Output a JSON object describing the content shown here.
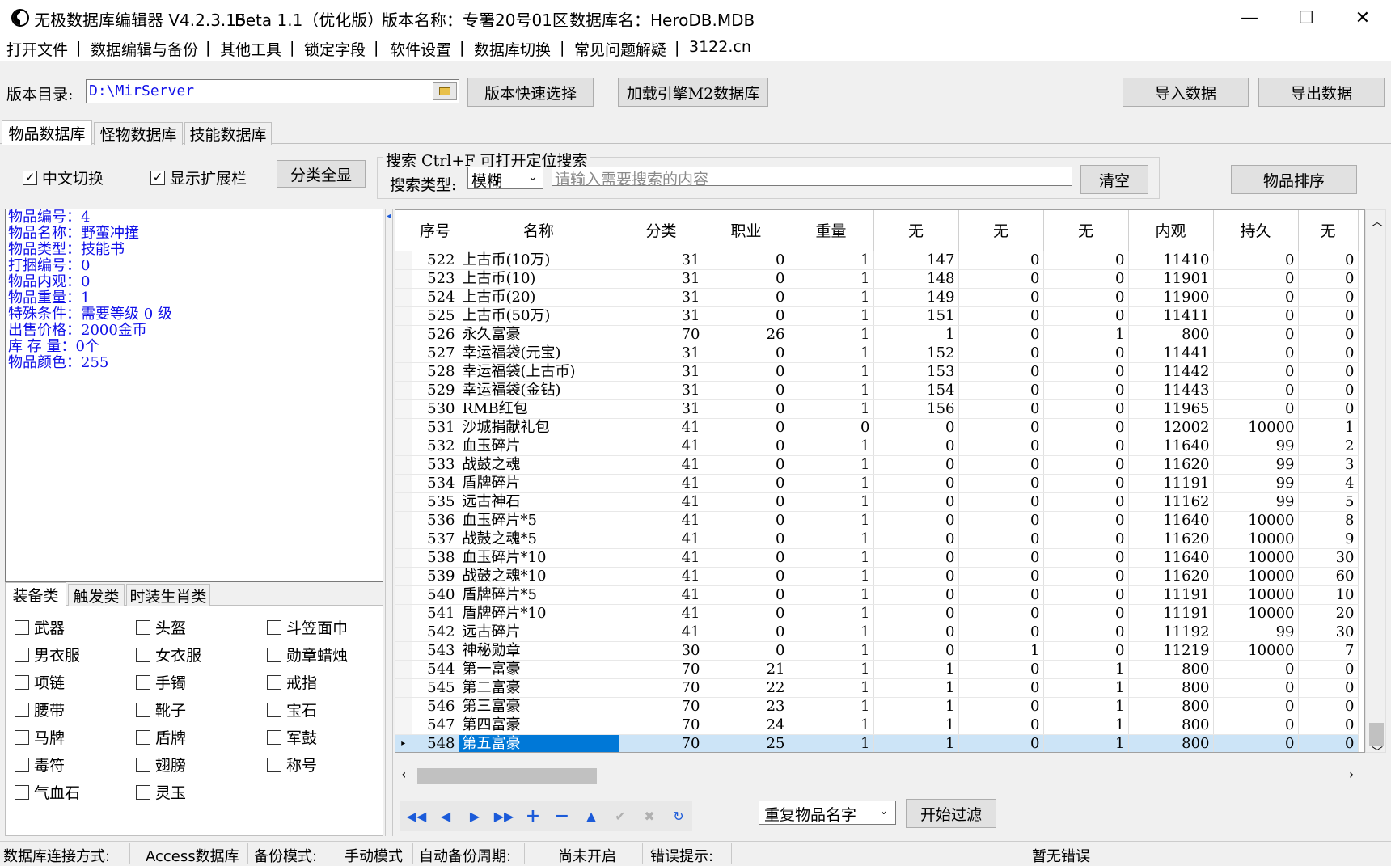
{
  "titlebar": {
    "app": "无极数据库编辑器 V4.2.3.15",
    "beta": "Beta 1.1（优化版）",
    "version_name": "版本名称：专署20号01区",
    "db_name": "数据库名：HeroDB.MDB",
    "minimize": "—",
    "maximize": "☐",
    "close": "✕"
  },
  "menu": [
    "打开文件",
    "数据编辑与备份",
    "其他工具",
    "锁定字段",
    "软件设置",
    "数据库切换",
    "常见问题解疑",
    "3122.cn"
  ],
  "menu_sep": "|",
  "toolbar": {
    "dir_label": "版本目录:",
    "dir_value": "D:\\MirServer",
    "quick_select": "版本快速选择",
    "load_m2": "加载引擎M2数据库",
    "import": "导入数据",
    "export": "导出数据"
  },
  "tabs": [
    "物品数据库",
    "怪物数据库",
    "技能数据库"
  ],
  "options": {
    "chinese_switch": "中文切换",
    "show_ext": "显示扩展栏",
    "show_all_cat": "分类全显",
    "check": "✓"
  },
  "search": {
    "group_title": "搜索  Ctrl+F 可打开定位搜索",
    "type_label": "搜索类型:",
    "type_value": "模糊",
    "placeholder": "请输入需要搜索的内容",
    "clear": "清空",
    "sort": "物品排序"
  },
  "info": [
    "物品编号：4",
    "物品名称：野蛮冲撞",
    "物品类型：技能书",
    "打捆编号：0",
    "物品内观：0",
    "物品重量：1",
    "特殊条件：需要等级 0 级",
    "出售价格：2000金币",
    "库 存 量：0个",
    "物品颜色：255"
  ],
  "category_tabs": [
    "装备类",
    "触发类",
    "时装生肖类"
  ],
  "categories": [
    [
      "武器",
      "头盔",
      "斗笠面巾"
    ],
    [
      "男衣服",
      "女衣服",
      "勋章蜡烛"
    ],
    [
      "项链",
      "手镯",
      "戒指"
    ],
    [
      "腰带",
      "靴子",
      "宝石"
    ],
    [
      "马牌",
      "盾牌",
      "军鼓"
    ],
    [
      "毒符",
      "翅膀",
      "称号"
    ],
    [
      "气血石",
      "灵玉"
    ]
  ],
  "grid": {
    "columns": [
      "序号",
      "名称",
      "分类",
      "职业",
      "重量",
      "无",
      "无",
      "无",
      "内观",
      "持久",
      "无"
    ],
    "rows": [
      [
        "522",
        "上古币(10万)",
        "31",
        "0",
        "1",
        "147",
        "0",
        "0",
        "11410",
        "0",
        "0"
      ],
      [
        "523",
        "上古币(10)",
        "31",
        "0",
        "1",
        "148",
        "0",
        "0",
        "11901",
        "0",
        "0"
      ],
      [
        "524",
        "上古币(20)",
        "31",
        "0",
        "1",
        "149",
        "0",
        "0",
        "11900",
        "0",
        "0"
      ],
      [
        "525",
        "上古币(50万)",
        "31",
        "0",
        "1",
        "151",
        "0",
        "0",
        "11411",
        "0",
        "0"
      ],
      [
        "526",
        "永久富豪",
        "70",
        "26",
        "1",
        "1",
        "0",
        "1",
        "800",
        "0",
        "0"
      ],
      [
        "527",
        "幸运福袋(元宝)",
        "31",
        "0",
        "1",
        "152",
        "0",
        "0",
        "11441",
        "0",
        "0"
      ],
      [
        "528",
        "幸运福袋(上古币)",
        "31",
        "0",
        "1",
        "153",
        "0",
        "0",
        "11442",
        "0",
        "0"
      ],
      [
        "529",
        "幸运福袋(金钻)",
        "31",
        "0",
        "1",
        "154",
        "0",
        "0",
        "11443",
        "0",
        "0"
      ],
      [
        "530",
        "RMB红包",
        "31",
        "0",
        "1",
        "156",
        "0",
        "0",
        "11965",
        "0",
        "0"
      ],
      [
        "531",
        "沙城捐献礼包",
        "41",
        "0",
        "0",
        "0",
        "0",
        "0",
        "12002",
        "10000",
        "1"
      ],
      [
        "532",
        "血玉碎片",
        "41",
        "0",
        "1",
        "0",
        "0",
        "0",
        "11640",
        "99",
        "2"
      ],
      [
        "533",
        "战鼓之魂",
        "41",
        "0",
        "1",
        "0",
        "0",
        "0",
        "11620",
        "99",
        "3"
      ],
      [
        "534",
        "盾牌碎片",
        "41",
        "0",
        "1",
        "0",
        "0",
        "0",
        "11191",
        "99",
        "4"
      ],
      [
        "535",
        "远古神石",
        "41",
        "0",
        "1",
        "0",
        "0",
        "0",
        "11162",
        "99",
        "5"
      ],
      [
        "536",
        "血玉碎片*5",
        "41",
        "0",
        "1",
        "0",
        "0",
        "0",
        "11640",
        "10000",
        "8"
      ],
      [
        "537",
        "战鼓之魂*5",
        "41",
        "0",
        "1",
        "0",
        "0",
        "0",
        "11620",
        "10000",
        "9"
      ],
      [
        "538",
        "血玉碎片*10",
        "41",
        "0",
        "1",
        "0",
        "0",
        "0",
        "11640",
        "10000",
        "30"
      ],
      [
        "539",
        "战鼓之魂*10",
        "41",
        "0",
        "1",
        "0",
        "0",
        "0",
        "11620",
        "10000",
        "60"
      ],
      [
        "540",
        "盾牌碎片*5",
        "41",
        "0",
        "1",
        "0",
        "0",
        "0",
        "11191",
        "10000",
        "10"
      ],
      [
        "541",
        "盾牌碎片*10",
        "41",
        "0",
        "1",
        "0",
        "0",
        "0",
        "11191",
        "10000",
        "20"
      ],
      [
        "542",
        "远古碎片",
        "41",
        "0",
        "1",
        "0",
        "0",
        "0",
        "11192",
        "99",
        "30"
      ],
      [
        "543",
        "神秘勋章",
        "30",
        "0",
        "1",
        "0",
        "1",
        "0",
        "11219",
        "10000",
        "7"
      ],
      [
        "544",
        "第一富豪",
        "70",
        "21",
        "1",
        "1",
        "0",
        "1",
        "800",
        "0",
        "0"
      ],
      [
        "545",
        "第二富豪",
        "70",
        "22",
        "1",
        "1",
        "0",
        "1",
        "800",
        "0",
        "0"
      ],
      [
        "546",
        "第三富豪",
        "70",
        "23",
        "1",
        "1",
        "0",
        "1",
        "800",
        "0",
        "0"
      ],
      [
        "547",
        "第四富豪",
        "70",
        "24",
        "1",
        "1",
        "0",
        "1",
        "800",
        "0",
        "0"
      ],
      [
        "548",
        "第五富豪",
        "70",
        "25",
        "1",
        "1",
        "0",
        "1",
        "800",
        "0",
        "0"
      ]
    ]
  },
  "bottom": {
    "filter_type": "重复物品名字",
    "start_filter": "开始过滤"
  },
  "status": {
    "conn_label": "数据库连接方式:",
    "conn_value": "Access数据库",
    "backup_label": "备份模式:",
    "backup_value": "手动模式",
    "auto_label": "自动备份周期:",
    "auto_value": "尚未开启",
    "error_label": "错误提示:",
    "error_value": "暂无错误"
  }
}
